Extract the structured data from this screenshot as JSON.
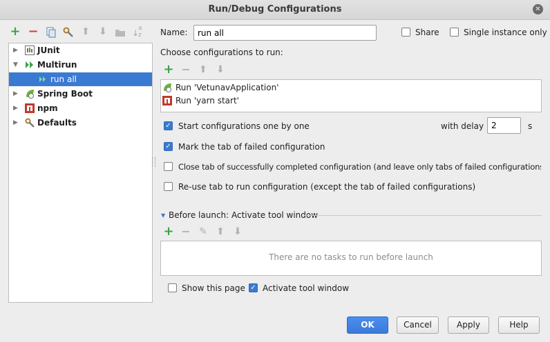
{
  "window": {
    "title": "Run/Debug Configurations",
    "close_glyph": "✕"
  },
  "left_toolbar": [
    {
      "name": "add-icon",
      "glyph": "+"
    },
    {
      "name": "remove-icon",
      "glyph": "−"
    },
    {
      "name": "copy-icon",
      "glyph": "⧉"
    },
    {
      "name": "wrench-icon",
      "glyph": "🔧"
    },
    {
      "name": "move-up-icon",
      "glyph": "⬆"
    },
    {
      "name": "move-down-icon",
      "glyph": "⬇"
    },
    {
      "name": "folder-icon",
      "glyph": "▬"
    },
    {
      "name": "sort-icon",
      "glyph": "↓"
    }
  ],
  "sort_icon_letters": {
    "top": "a",
    "bottom": "z"
  },
  "tree": {
    "items": [
      {
        "label": "JUnit",
        "expanded": false,
        "icon": "junit-icon"
      },
      {
        "label": "Multirun",
        "expanded": true,
        "icon": "multirun-icon"
      },
      {
        "label": "run all",
        "selected": true,
        "icon": "multirun-child-icon"
      },
      {
        "label": "Spring Boot",
        "expanded": false,
        "icon": "spring-boot-icon"
      },
      {
        "label": "npm",
        "expanded": false,
        "icon": "npm-icon"
      },
      {
        "label": "Defaults",
        "expanded": false,
        "icon": "wrench-icon"
      }
    ]
  },
  "form": {
    "name_label": "Name:",
    "name_value": "run all",
    "share_label": "Share",
    "share_checked": false,
    "single_instance_label": "Single instance only",
    "single_instance_checked": false,
    "choose_label": "Choose configurations to run:",
    "configs": [
      {
        "label": "Run 'VetunavApplication'",
        "icon": "spring-boot-icon"
      },
      {
        "label": "Run 'yarn start'",
        "icon": "npm-icon"
      }
    ],
    "options": [
      {
        "label": "Start configurations one by one",
        "checked": true
      },
      {
        "label": "Mark the tab of failed configuration",
        "checked": true
      },
      {
        "label": "Close tab of successfully completed configuration (and leave only tabs of failed configurations)",
        "checked": false
      },
      {
        "label": "Re-use tab to run configuration (except the tab of failed configurations)",
        "checked": false
      }
    ],
    "delay_label": "with delay",
    "delay_value": "2",
    "delay_unit": "s",
    "before_launch_label": "Before launch: Activate tool window",
    "before_launch_empty": "There are no tasks to run before launch",
    "show_page_label": "Show this page",
    "show_page_checked": false,
    "activate_tool_label": "Activate tool window",
    "activate_tool_checked": true
  },
  "buttons": {
    "ok": "OK",
    "cancel": "Cancel",
    "apply": "Apply",
    "help": "Help"
  },
  "colors": {
    "accent": "#3a7ad3",
    "add_green": "#3aa34b",
    "remove_red": "#d2403a",
    "npm_red": "#c0392b",
    "spring_green": "#6db33f"
  }
}
